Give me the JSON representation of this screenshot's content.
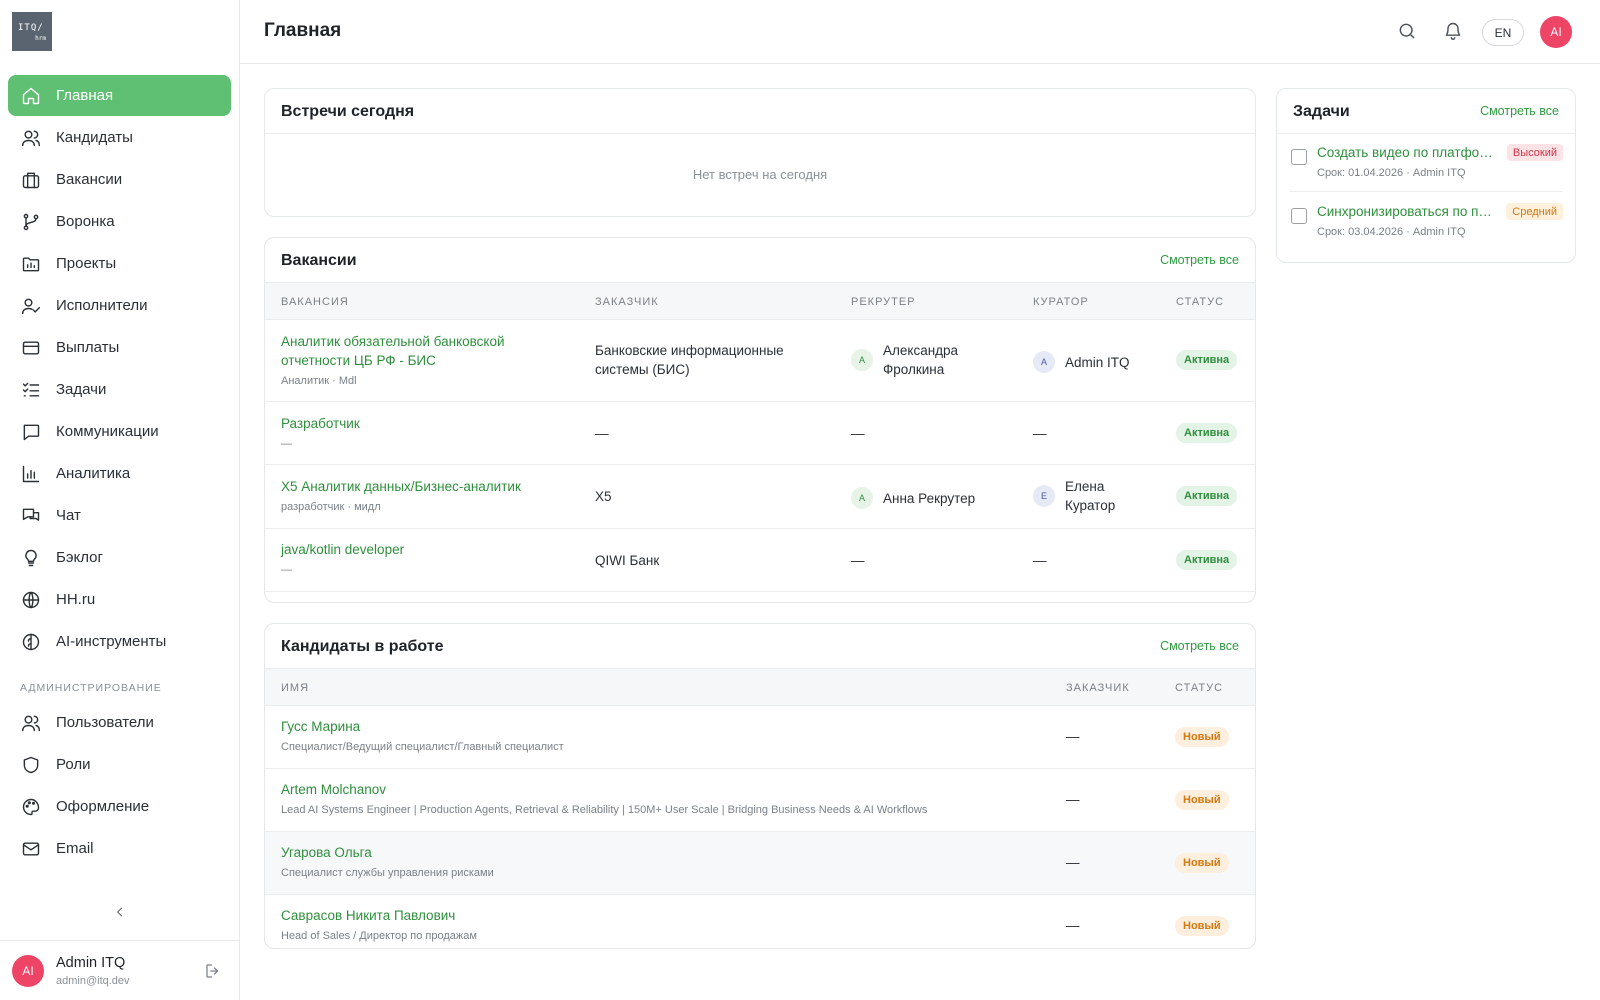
{
  "logo": {
    "top": "ITQ/",
    "bottom": "hrm"
  },
  "sidebar": {
    "items": [
      {
        "label": "Главная",
        "icon": "home-icon"
      },
      {
        "label": "Кандидаты",
        "icon": "users-icon"
      },
      {
        "label": "Вакансии",
        "icon": "briefcase-icon"
      },
      {
        "label": "Воронка",
        "icon": "git-branch-icon"
      },
      {
        "label": "Проекты",
        "icon": "folder-icon"
      },
      {
        "label": "Исполнители",
        "icon": "user-check-icon"
      },
      {
        "label": "Выплаты",
        "icon": "credit-card-icon"
      },
      {
        "label": "Задачи",
        "icon": "list-checks-icon"
      },
      {
        "label": "Коммуникации",
        "icon": "message-square-icon"
      },
      {
        "label": "Аналитика",
        "icon": "bar-chart-icon"
      },
      {
        "label": "Чат",
        "icon": "chat-bubbles-icon"
      },
      {
        "label": "Бэклог",
        "icon": "lightbulb-icon"
      },
      {
        "label": "HH.ru",
        "icon": "globe-icon"
      },
      {
        "label": "AI-инструменты",
        "icon": "brain-icon"
      }
    ],
    "admin_section": "АДМИНИСТРИРОВАНИЕ",
    "admin_items": [
      {
        "label": "Пользователи",
        "icon": "users-icon"
      },
      {
        "label": "Роли",
        "icon": "shield-icon"
      },
      {
        "label": "Оформление",
        "icon": "palette-icon"
      },
      {
        "label": "Email",
        "icon": "mail-icon"
      }
    ]
  },
  "user": {
    "initials": "AI",
    "name": "Admin ITQ",
    "email": "admin@itq.dev"
  },
  "header": {
    "title": "Главная",
    "lang": "EN",
    "avatar_initials": "AI"
  },
  "meetings": {
    "title": "Встречи сегодня",
    "empty": "Нет встреч на сегодня"
  },
  "vacancies": {
    "title": "Вакансии",
    "see_all": "Смотреть все",
    "columns": [
      "ВАКАНСИЯ",
      "ЗАКАЗЧИК",
      "РЕКРУТЕР",
      "КУРАТОР",
      "СТАТУС"
    ],
    "rows": [
      {
        "title1": "Аналитик обязательной банковской",
        "title2": "отчетности ЦБ РФ - БИС",
        "sub": "Аналитик · Mdl",
        "client1": "Банковские информационные",
        "client2": "системы (БИС)",
        "rec_initial": "А",
        "rec1": "Александра",
        "rec2": "Фролкина",
        "cur_initial": "A",
        "cur1": "Admin ITQ",
        "cur2": "",
        "status": "Активна"
      },
      {
        "title1": "Разработчик",
        "title2": "",
        "sub": "—",
        "client1": "—",
        "client2": "",
        "rec_initial": "",
        "rec1": "—",
        "rec2": "",
        "cur_initial": "",
        "cur1": "—",
        "cur2": "",
        "status": "Активна"
      },
      {
        "title1": "X5 Аналитик данных/Бизнес-аналитик",
        "title2": "",
        "sub": "разработчик · мидл",
        "client1": "X5",
        "client2": "",
        "rec_initial": "А",
        "rec1": "Анна Рекрутер",
        "rec2": "",
        "cur_initial": "Е",
        "cur1": "Елена",
        "cur2": "Куратор",
        "status": "Активна"
      },
      {
        "title1": "java/kotlin developer",
        "title2": "",
        "sub": "—",
        "client1": "QIWI Банк",
        "client2": "",
        "rec_initial": "",
        "rec1": "—",
        "rec2": "",
        "cur_initial": "",
        "cur1": "—",
        "cur2": "",
        "status": "Активна"
      }
    ]
  },
  "candidates": {
    "title": "Кандидаты в работе",
    "see_all": "Смотреть все",
    "columns": [
      "ИМЯ",
      "ЗАКАЗЧИК",
      "СТАТУС"
    ],
    "rows": [
      {
        "name": "Гусс Марина",
        "sub": "Специалист/Ведущий специалист/Главный специалист",
        "client": "—",
        "status": "Новый"
      },
      {
        "name": "Artem Molchanov",
        "sub": "Lead AI Systems Engineer | Production Agents, Retrieval & Reliability | 150M+ User Scale | Bridging Business Needs & AI Workflows",
        "client": "—",
        "status": "Новый"
      },
      {
        "name": "Угарова Ольга",
        "sub": "Специалист службы управления рисками",
        "client": "—",
        "status": "Новый"
      },
      {
        "name": "Саврасов Никита Павлович",
        "sub": "Head of Sales / Директор по продажам",
        "client": "—",
        "status": "Новый"
      }
    ]
  },
  "tasks": {
    "title": "Задачи",
    "see_all": "Смотреть все",
    "items": [
      {
        "title": "Создать видео по платформе",
        "meta": "Срок: 01.04.2026 · Admin ITQ",
        "priority": "Высокий"
      },
      {
        "title": "Синхронизироваться по проекту",
        "meta": "Срок: 03.04.2026 · Admin ITQ",
        "priority": "Средний"
      }
    ]
  },
  "colors": {
    "accent": "#5fbf72",
    "link": "#2f8f3d",
    "avatar": "#ee4466"
  }
}
